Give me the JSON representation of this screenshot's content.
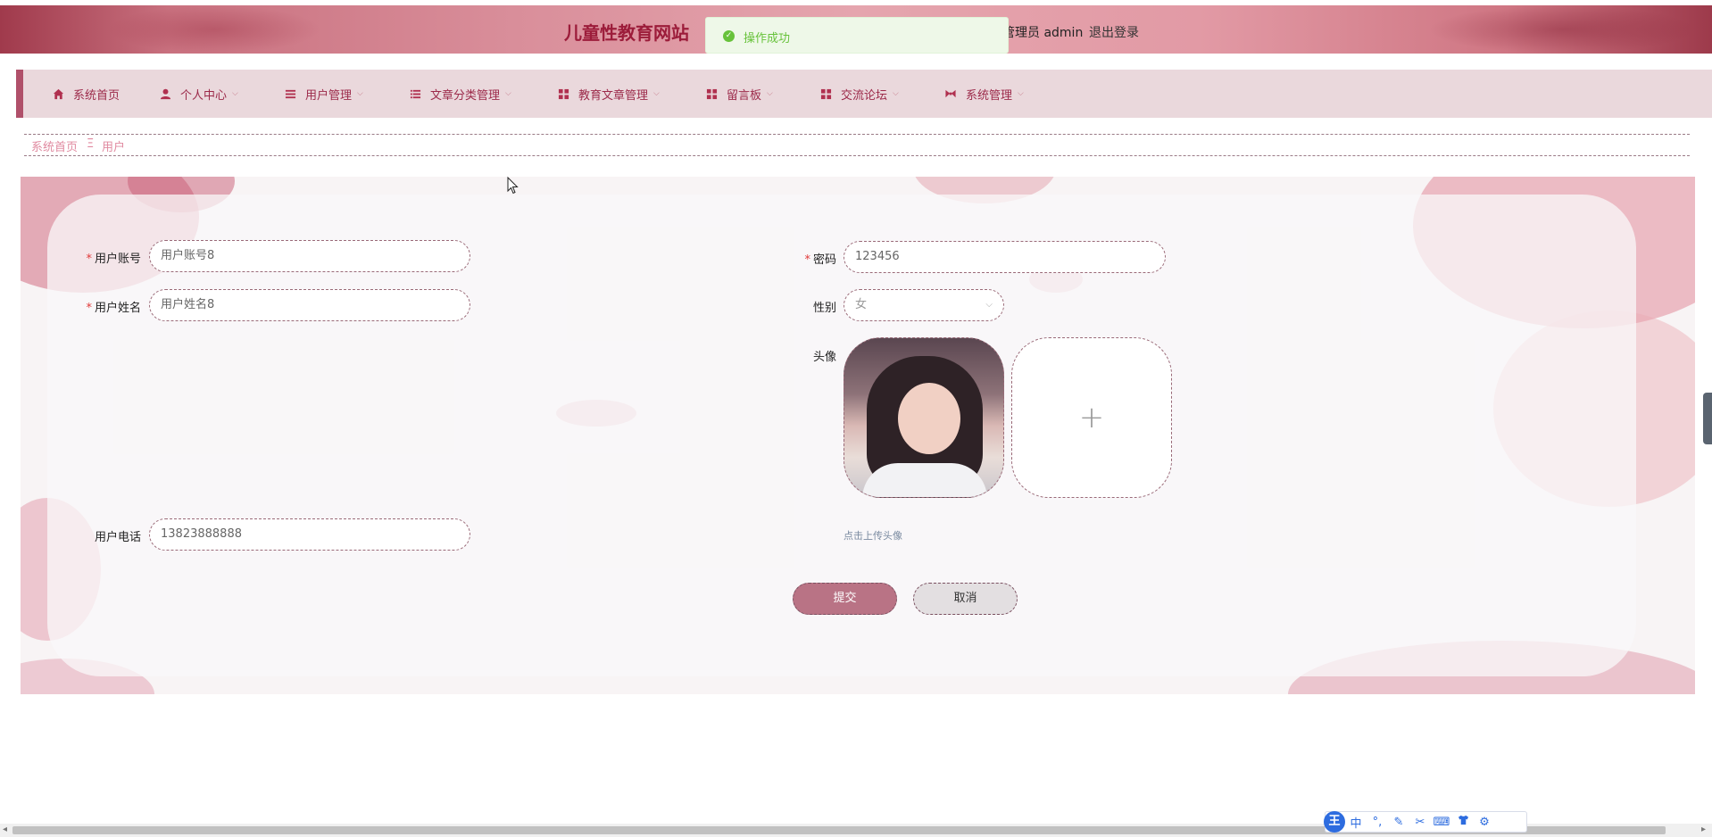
{
  "header": {
    "site_title": "儿童性教育网站",
    "user_info": "管理员 admin",
    "logout": "退出登录"
  },
  "toast": {
    "message": "操作成功",
    "icon": "success-check-icon",
    "color": "#67c23a"
  },
  "nav": {
    "items": [
      {
        "label": "系统首页",
        "icon": "home-icon",
        "has_caret": false
      },
      {
        "label": "个人中心",
        "icon": "person-icon",
        "has_caret": true
      },
      {
        "label": "用户管理",
        "icon": "list-icon",
        "has_caret": true
      },
      {
        "label": "文章分类管理",
        "icon": "list-icon",
        "has_caret": true
      },
      {
        "label": "教育文章管理",
        "icon": "grid-icon",
        "has_caret": true
      },
      {
        "label": "留言板",
        "icon": "grid-icon",
        "has_caret": true
      },
      {
        "label": "交流论坛",
        "icon": "grid-icon",
        "has_caret": true
      },
      {
        "label": "系统管理",
        "icon": "bow-icon",
        "has_caret": true
      }
    ]
  },
  "breadcrumb": {
    "home": "系统首页",
    "separator": "Ξ",
    "current": "用户"
  },
  "form": {
    "account": {
      "label": "用户账号",
      "required": true,
      "value": "用户账号8"
    },
    "password": {
      "label": "密码",
      "required": true,
      "value": "123456"
    },
    "name": {
      "label": "用户姓名",
      "required": true,
      "value": "用户姓名8"
    },
    "gender": {
      "label": "性别",
      "value": "女"
    },
    "avatar": {
      "label": "头像",
      "upload_hint": "点击上传头像",
      "add_symbol": "+"
    },
    "phone": {
      "label": "用户电话",
      "value": "13823888888"
    },
    "submit": "提交",
    "cancel": "取消"
  },
  "ime": {
    "logo": "王",
    "mode": "中",
    "punct": "°,"
  },
  "colors": {
    "accent": "#9c1c3a",
    "nav_bg": "#ead8dc",
    "nav_text": "#9c2a4a",
    "submit_bg": "#b97385",
    "breadcrumb": "#e08aa0"
  }
}
